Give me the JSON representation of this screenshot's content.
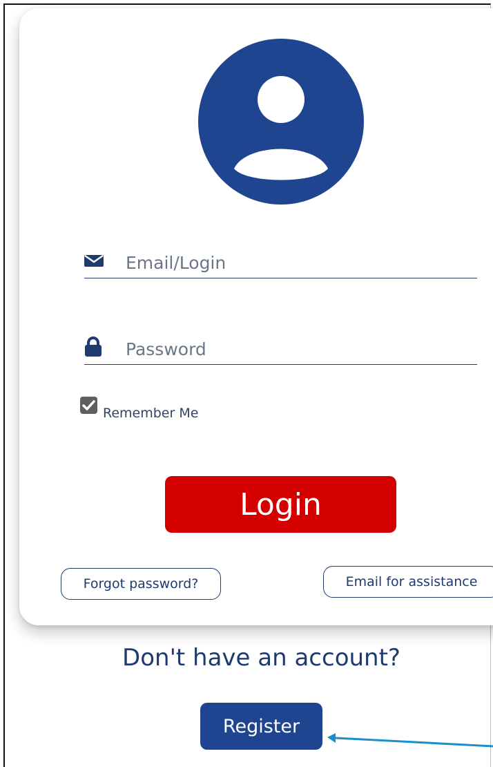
{
  "login_form": {
    "email_placeholder": "Email/Login",
    "password_placeholder": "Password",
    "remember_label": "Remember Me",
    "remember_checked": true,
    "login_label": "Login",
    "forgot_label": "Forgot password?",
    "assist_label": "Email for assistance"
  },
  "register_section": {
    "prompt": "Don't have an account?",
    "register_label": "Register"
  },
  "icons": {
    "avatar": "user-avatar-icon",
    "email": "envelope-icon",
    "password": "lock-icon",
    "checkbox": "checkmark-icon",
    "annotation": "arrow-pointer"
  },
  "colors": {
    "primary": "#1f4590",
    "login_button": "#d40000",
    "text": "#1f3a6e",
    "annotation_arrow": "#1a8fcc"
  }
}
